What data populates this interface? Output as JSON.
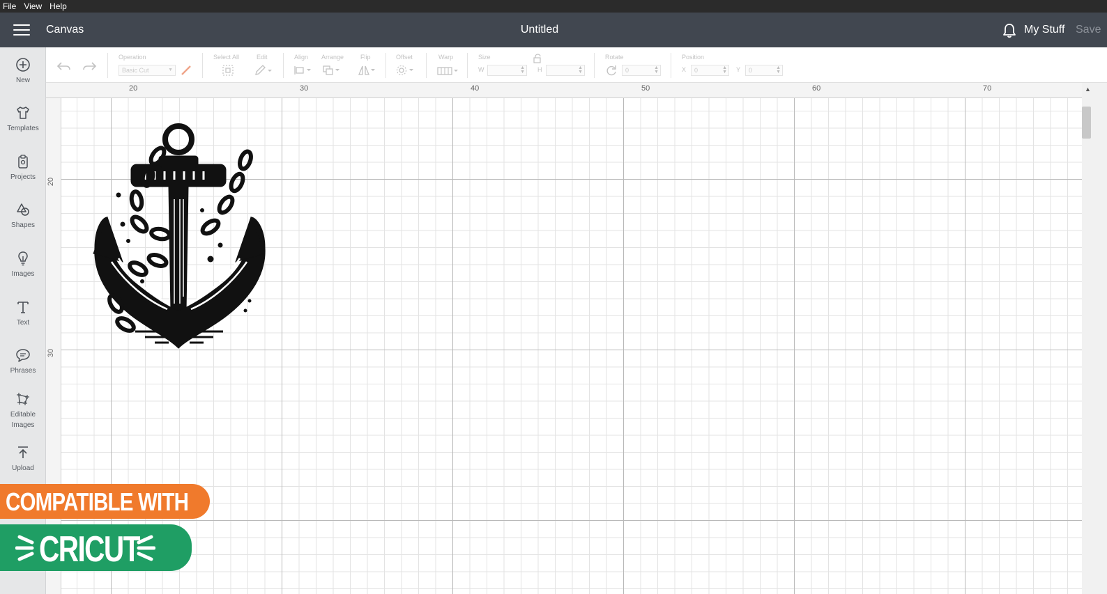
{
  "menubar": {
    "items": [
      "File",
      "View",
      "Help"
    ]
  },
  "header": {
    "app_name": "Canvas",
    "doc_title": "Untitled",
    "my_stuff": "My Stuff",
    "save": "Save"
  },
  "sidebar": {
    "items": [
      {
        "label": "New",
        "icon": "plus-circle-icon"
      },
      {
        "label": "Templates",
        "icon": "shirt-icon"
      },
      {
        "label": "Projects",
        "icon": "clipboard-icon"
      },
      {
        "label": "Shapes",
        "icon": "shapes-icon"
      },
      {
        "label": "Images",
        "icon": "lightbulb-icon"
      },
      {
        "label": "Text",
        "icon": "text-icon"
      },
      {
        "label": "Phrases",
        "icon": "speech-bubble-icon"
      },
      {
        "label": "Editable Images",
        "label_line1": "Editable",
        "label_line2": "Images",
        "icon": "editable-image-icon"
      },
      {
        "label": "Upload",
        "icon": "upload-icon"
      }
    ]
  },
  "toolbar": {
    "operation_label": "Operation",
    "operation_value": "Basic Cut",
    "select_all_label": "Select All",
    "edit_label": "Edit",
    "align_label": "Align",
    "arrange_label": "Arrange",
    "flip_label": "Flip",
    "offset_label": "Offset",
    "warp_label": "Warp",
    "size_label": "Size",
    "w_label": "W",
    "h_label": "H",
    "rotate_label": "Rotate",
    "rotate_value": "0",
    "position_label": "Position",
    "x_label": "X",
    "x_value": "0",
    "y_label": "Y",
    "y_value": "0"
  },
  "ruler": {
    "top_ticks": [
      "20",
      "30",
      "40",
      "50",
      "60",
      "70"
    ],
    "left_ticks": [
      "20",
      "30"
    ]
  },
  "badges": {
    "compatible": "COMPATIBLE WITH",
    "brand": "CRICUT"
  },
  "colors": {
    "header": "#414750",
    "menubar": "#2b2b2b",
    "sidebar": "#e6e7e8",
    "badge_orange": "#f07a2c",
    "badge_green": "#1f9e64"
  }
}
